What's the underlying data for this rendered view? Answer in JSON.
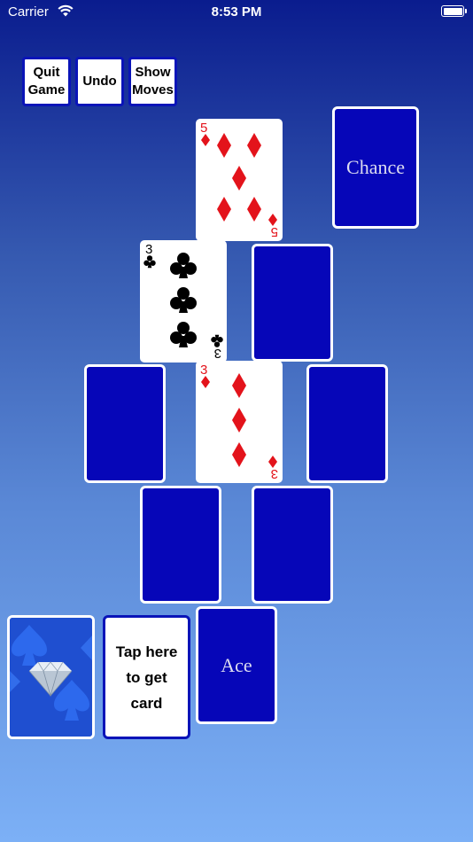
{
  "status_bar": {
    "carrier": "Carrier",
    "time": "8:53 PM"
  },
  "toolbar": {
    "quit_label": "Quit\nGame",
    "undo_label": "Undo",
    "show_moves_label": "Show\nMoves"
  },
  "cards": {
    "top_face": {
      "rank": "5",
      "suit": "diamonds",
      "color": "#e3131b"
    },
    "left_face": {
      "rank": "3",
      "suit": "clubs",
      "color": "#000000"
    },
    "center_face": {
      "rank": "3",
      "suit": "diamonds",
      "color": "#e3131b"
    },
    "chance_label": "Chance",
    "ace_label": "Ace"
  },
  "deck": {
    "tap_label": "Tap here\nto get\ncard"
  },
  "colors": {
    "card_back": "#0606b8",
    "button_border": "#0a14b8",
    "background_top": "#0a1c8e",
    "background_bottom": "#7cb0f6"
  }
}
